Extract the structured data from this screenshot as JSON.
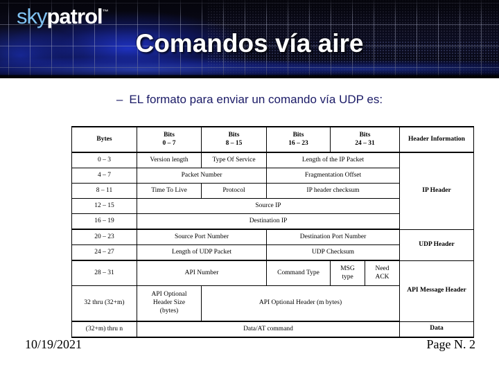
{
  "banner": {
    "logo_primary": "sky",
    "logo_secondary": "patrol",
    "logo_tm": "™",
    "title": "Comandos vía aire",
    "accent_color": "#1e3ce6",
    "background_color": "#05050d",
    "title_color": "#ffffff"
  },
  "slide": {
    "bullet_dash": "–",
    "bullet_text": "EL formato para enviar un comando vía UDP es:",
    "bullet_color": "#1a1a66"
  },
  "table": {
    "header": {
      "bytes": "Bytes",
      "bits_0_7_line1": "Bits",
      "bits_0_7_line2": "0 – 7",
      "bits_8_15_line1": "Bits",
      "bits_8_15_line2": "8 – 15",
      "bits_16_23_line1": "Bits",
      "bits_16_23_line2": "16 – 23",
      "bits_24_31_line1": "Bits",
      "bits_24_31_line2": "24 – 31",
      "header_information": "Header Information"
    },
    "rows": [
      {
        "bytes": "0 – 3",
        "cells": [
          "Version length",
          "Type Of Service",
          "Length of the IP Packet"
        ]
      },
      {
        "bytes": "4 – 7",
        "cells": [
          "Packet Number",
          "Fragmentation Offset"
        ]
      },
      {
        "bytes": "8 – 11",
        "cells": [
          "Time  To Live",
          "Protocol",
          "IP header checksum"
        ]
      },
      {
        "bytes": "12 – 15",
        "cells": [
          "Source IP"
        ]
      },
      {
        "bytes": "16 – 19",
        "cells": [
          "Destination IP"
        ]
      },
      {
        "bytes": "20 – 23",
        "cells": [
          "Source Port Number",
          "Destination Port Number"
        ]
      },
      {
        "bytes": "24 – 27",
        "cells": [
          "Length of UDP Packet",
          "UDP Checksum"
        ]
      },
      {
        "bytes": "28 – 31",
        "cells": [
          "API Number",
          "Command Type",
          "MSG\ntype",
          "Need\nACK"
        ]
      },
      {
        "bytes": "32 thru (32+m)",
        "cells": [
          "API Optional\nHeader Size\n(bytes)",
          "API Optional Header (m bytes)"
        ]
      },
      {
        "bytes": "(32+m) thru n",
        "cells": [
          "Data/AT command"
        ]
      }
    ],
    "groups": {
      "ip_header": "IP Header",
      "udp_header": "UDP Header",
      "api_message_header": "API Message Header",
      "data": "Data"
    }
  },
  "footer": {
    "date": "10/19/2021",
    "page": "Page N. 2"
  }
}
